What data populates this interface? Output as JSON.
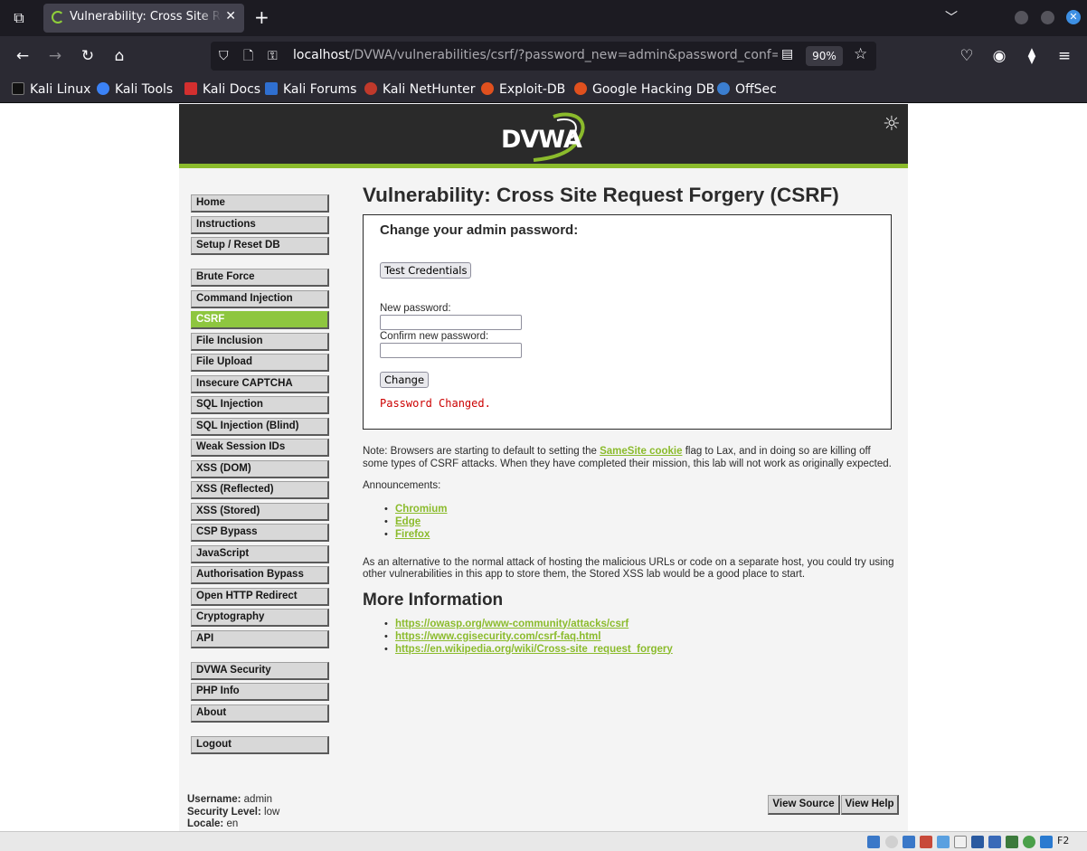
{
  "browser": {
    "tab_title": "Vulnerability: Cross Site Request Forgery (CSRF) :: Damn Vulnerable Web Application (DVWA)",
    "tab_close": "✕",
    "new_tab": "+",
    "url_host": "localhost",
    "url_path": "/DVWA/vulnerabilities/csrf/?password_new=admin&password_conf=",
    "zoom": "90%",
    "bookmarks": [
      "Kali Linux",
      "Kali Tools",
      "Kali Docs",
      "Kali Forums",
      "Kali NetHunter",
      "Exploit-DB",
      "Google Hacking DB",
      "OffSec"
    ],
    "bookmark_colors": [
      "#111111",
      "#3b82f6",
      "#d32f2f",
      "#2f6fd0",
      "#c0392b",
      "#e0501e",
      "#e0501e",
      "#3b7ed0"
    ]
  },
  "dvwa": {
    "logo": "DVWA",
    "menu": {
      "group1": [
        "Home",
        "Instructions",
        "Setup / Reset DB"
      ],
      "group2": [
        "Brute Force",
        "Command Injection",
        "CSRF",
        "File Inclusion",
        "File Upload",
        "Insecure CAPTCHA",
        "SQL Injection",
        "SQL Injection (Blind)",
        "Weak Session IDs",
        "XSS (DOM)",
        "XSS (Reflected)",
        "XSS (Stored)",
        "CSP Bypass",
        "JavaScript",
        "Authorisation Bypass",
        "Open HTTP Redirect",
        "Cryptography",
        "API"
      ],
      "group3": [
        "DVWA Security",
        "PHP Info",
        "About"
      ],
      "group4": [
        "Logout"
      ],
      "selected": "CSRF"
    },
    "page_title": "Vulnerability: Cross Site Request Forgery (CSRF)",
    "box": {
      "heading": "Change your admin password:",
      "test_button": "Test Credentials",
      "new_label": "New password:",
      "confirm_label": "Confirm new password:",
      "new_value": "",
      "confirm_value": "",
      "change_button": "Change",
      "status": "Password Changed."
    },
    "note": {
      "prefix": "Note: Browsers are starting to default to setting the ",
      "link": "SameSite cookie",
      "suffix": " flag to Lax, and in doing so are killing off some types of CSRF attacks. When they have completed their mission, this lab will not work as originally expected."
    },
    "announcements_label": "Announcements:",
    "announcements": [
      "Chromium",
      "Edge",
      "Firefox"
    ],
    "alternative": "As an alternative to the normal attack of hosting the malicious URLs or code on a separate host, you could try using other vulnerabilities in this app to store them, the Stored XSS lab would be a good place to start.",
    "more_info_title": "More Information",
    "more_info_links": [
      "https://owasp.org/www-community/attacks/csrf",
      "https://www.cgisecurity.com/csrf-faq.html",
      "https://en.wikipedia.org/wiki/Cross-site_request_forgery"
    ],
    "footer": {
      "username_label": "Username:",
      "username": "admin",
      "security_label": "Security Level:",
      "security": "low",
      "locale_label": "Locale:",
      "locale": "en",
      "view_source": "View Source",
      "view_help": "View Help"
    },
    "accent_color": "#8bbb2c"
  },
  "statusbar": {
    "host_key": "F2"
  }
}
